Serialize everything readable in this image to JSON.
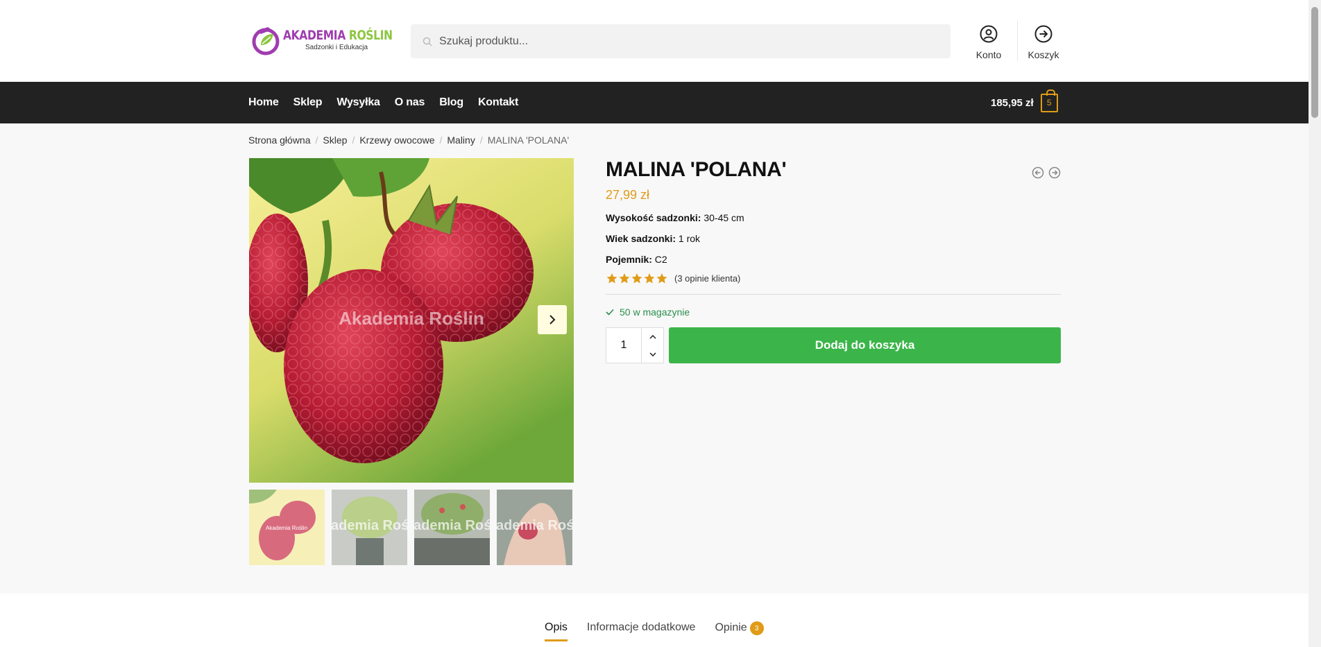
{
  "header": {
    "logo": {
      "title_part1": "AKADEMIA ",
      "title_part2": "ROŚLIN",
      "subtitle": "Sadzonki i Edukacja"
    },
    "search": {
      "placeholder": "Szukaj produktu..."
    },
    "account_label": "Konto",
    "cart_label": "Koszyk"
  },
  "nav": {
    "items": [
      "Home",
      "Sklep",
      "Wysyłka",
      "O nas",
      "Blog",
      "Kontakt"
    ],
    "cart_total": "185,95 zł",
    "cart_count": "5"
  },
  "breadcrumb": {
    "items": [
      "Strona główna",
      "Sklep",
      "Krzewy owocowe",
      "Maliny"
    ],
    "current": "MALINA 'POLANA'"
  },
  "gallery": {
    "watermark": "Akademia Roślin",
    "thumb_watermark": "Akademia Roślin"
  },
  "product": {
    "title": "MALINA 'POLANA'",
    "price": "27,99 zł",
    "attributes": [
      {
        "label": "Wysokość sadzonki:",
        "value": "30-45 cm"
      },
      {
        "label": "Wiek sadzonki:",
        "value": "1 rok"
      },
      {
        "label": "Pojemnik:",
        "value": "C2"
      }
    ],
    "rating_stars": 5,
    "reviews_text": "(3 opinie klienta)",
    "stock": "50 w magazynie",
    "quantity": "1",
    "add_to_cart": "Dodaj do koszyka"
  },
  "tabs": {
    "items": [
      "Opis",
      "Informacje dodatkowe",
      "Opinie"
    ],
    "reviews_count": "3"
  },
  "colors": {
    "accent": "#e09c17",
    "green_button": "#3bb54a",
    "nav_bg": "#222222"
  }
}
